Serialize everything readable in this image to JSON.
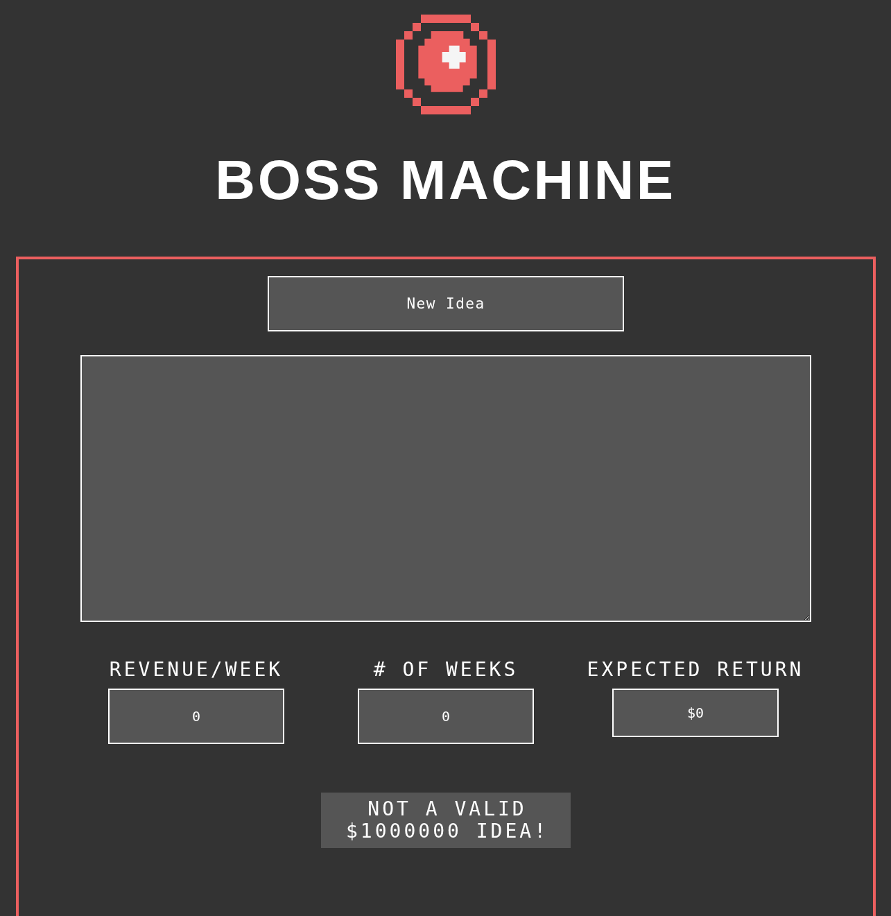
{
  "title": "BOSS MACHINE",
  "new_idea_button": "New Idea",
  "fields": [
    {
      "label": "REVENUE/WEEK",
      "value": "0",
      "kind": "input"
    },
    {
      "label": "# OF WEEKS",
      "value": "0",
      "kind": "input"
    },
    {
      "label": "EXPECTED RETURN",
      "value": "$0",
      "kind": "output"
    }
  ],
  "message": "NOT A VALID $1000000 IDEA!"
}
